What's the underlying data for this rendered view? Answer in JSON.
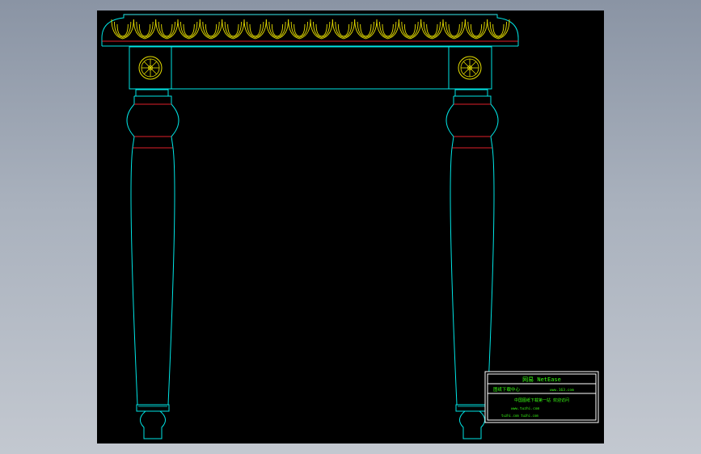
{
  "drawing": {
    "colors": {
      "outline": "#00e5e5",
      "accent_red": "#e0202a",
      "carving": "#e8e000",
      "title_block": "#ffffff",
      "title_text": "#39ff14"
    },
    "title_block": {
      "line1": "网易 NetEase",
      "line2_left": "图纸下载中心",
      "line2_right": "www.163.com",
      "line3": "中国图纸下载第一站 欢迎访问",
      "line4": "www.tuzhi.com",
      "line5": "tuzhi.com  tuzhi.com"
    }
  }
}
